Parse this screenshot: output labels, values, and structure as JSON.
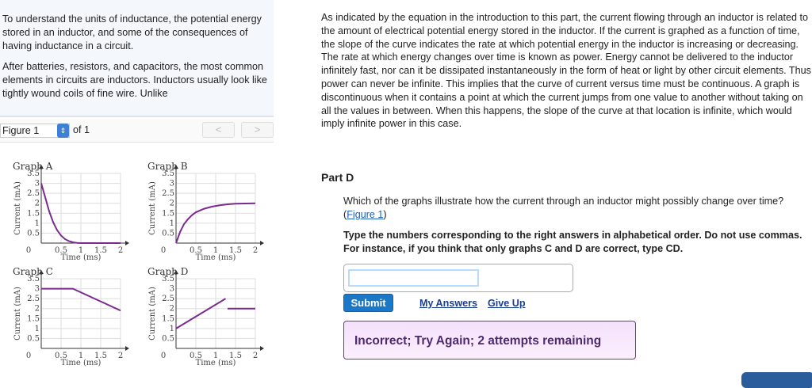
{
  "intro": {
    "p1": "To understand the units of inductance, the potential energy stored in an inductor, and some of the consequences of having inductance in a circuit.",
    "p2": "After batteries, resistors, and capacitors, the most common elements in circuits are inductors. Inductors usually look like tightly wound coils of fine wire. Unlike"
  },
  "figure_nav": {
    "selected": "Figure 1",
    "of": "of 1",
    "prev": "<",
    "next": ">"
  },
  "explanation": "As indicated by the equation in the introduction to this part, the current flowing through an inductor is related to the amount of electrical potential energy stored in the inductor. If the current is graphed as a function of time, the slope of the curve indicates the rate at which potential energy in the inductor is increasing or decreasing. The rate at which energy changes over time is known as power. Energy cannot be delivered to the inductor infinitely fast, nor can it be dissipated instantaneously in the form of heat or light by other circuit elements. Thus power can never be infinite. This implies that the curve of current versus time must be continuous. A graph is discontinuous when it contains a point at which the current jumps from one value to another without taking on all the values in between. When this happens, the slope of the curve at that location is infinite, which would imply infinite power in this case.",
  "part": "Part D",
  "question": "Which of the graphs illustrate how the current through an inductor might possibly change over time?(",
  "question_link": "Figure 1",
  "question_end": ")",
  "instructions": "Type the numbers corresponding to the right answers in alphabetical order. Do not use commas. For instance, if you think that only graphs C and D are correct, type CD.",
  "answer": {
    "value": "",
    "placeholder": ""
  },
  "buttons": {
    "submit": "Submit",
    "my_answers": "My Answers",
    "give_up": "Give Up"
  },
  "feedback": "Incorrect; Try Again; 2 attempts remaining",
  "colors": {
    "curve": "#7b2a8f",
    "submit": "#1b78c8",
    "feedback_border": "#6b3a8a"
  },
  "chart_data": [
    {
      "type": "line",
      "title": "Graph A",
      "xlabel": "Time (ms)",
      "ylabel": "Current (mA)",
      "xlim": [
        0,
        2
      ],
      "ylim": [
        0,
        3.5
      ],
      "xticks": [
        "0",
        "0.5",
        "1",
        "1.5",
        "2"
      ],
      "yticks": [
        "0.5",
        "1",
        "1.5",
        "2",
        "2.5",
        "3",
        "3.5"
      ],
      "x": [
        0,
        0.1,
        0.2,
        0.3,
        0.4,
        0.5,
        0.6,
        0.7,
        0.8,
        0.9,
        1,
        2
      ],
      "y": [
        3,
        2.3,
        1.6,
        1.05,
        0.65,
        0.38,
        0.2,
        0.1,
        0.04,
        0.01,
        0,
        0
      ]
    },
    {
      "type": "line",
      "title": "Graph B",
      "xlabel": "Time (ms)",
      "ylabel": "Current (mA)",
      "xlim": [
        0,
        2
      ],
      "ylim": [
        0,
        3.5
      ],
      "xticks": [
        "0",
        "0.5",
        "1",
        "1.5",
        "2"
      ],
      "yticks": [
        "0.5",
        "1",
        "1.5",
        "2",
        "2.5",
        "3",
        "3.5"
      ],
      "x": [
        0,
        0.1,
        0.2,
        0.3,
        0.4,
        0.5,
        0.7,
        0.9,
        1.1,
        1.3,
        1.5,
        2
      ],
      "y": [
        0,
        0.55,
        0.95,
        1.2,
        1.4,
        1.55,
        1.72,
        1.83,
        1.9,
        1.95,
        1.98,
        2
      ]
    },
    {
      "type": "line",
      "title": "Graph C",
      "xlabel": "Time (ms)",
      "ylabel": "Current (mA)",
      "xlim": [
        0,
        2
      ],
      "ylim": [
        0,
        3.5
      ],
      "xticks": [
        "0",
        "0.5",
        "1",
        "1.5",
        "2"
      ],
      "yticks": [
        "0.5",
        "1",
        "1.5",
        "2",
        "2.5",
        "3",
        "3.5"
      ],
      "x": [
        0,
        0.8,
        2
      ],
      "y": [
        3,
        3,
        1.9
      ]
    },
    {
      "type": "line",
      "title": "Graph D",
      "xlabel": "Time (ms)",
      "ylabel": "Current (mA)",
      "xlim": [
        0,
        2
      ],
      "ylim": [
        0,
        3.5
      ],
      "xticks": [
        "0",
        "0.5",
        "1",
        "1.5",
        "2"
      ],
      "yticks": [
        "0.5",
        "1",
        "1.5",
        "2",
        "2.5",
        "3",
        "3.5"
      ],
      "segments": [
        {
          "x": [
            0,
            1.25
          ],
          "y": [
            1,
            2.5
          ]
        },
        {
          "x": [
            1.3,
            2
          ],
          "y": [
            2,
            2
          ]
        }
      ]
    }
  ]
}
